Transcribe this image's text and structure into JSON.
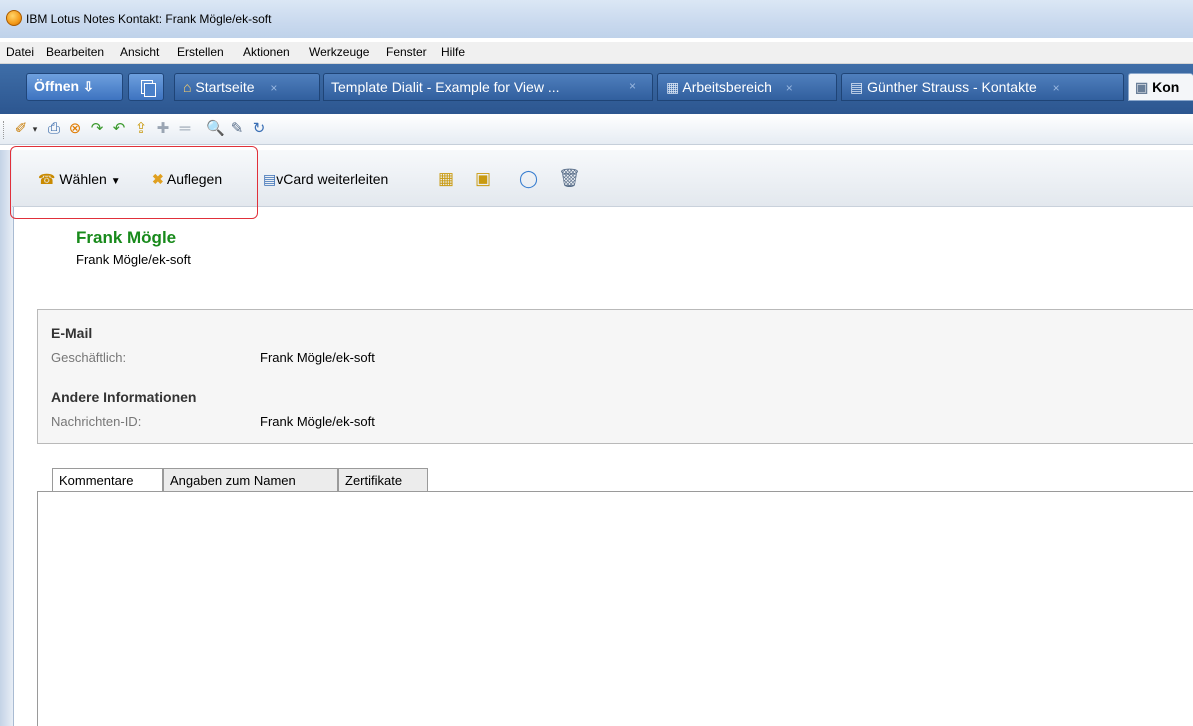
{
  "window": {
    "title": "IBM Lotus Notes Kontakt: Frank Mögle/ek-soft"
  },
  "menu": [
    "Datei",
    "Bearbeiten",
    "Ansicht",
    "Erstellen",
    "Aktionen",
    "Werkzeuge",
    "Fenster",
    "Hilfe"
  ],
  "tabstrip": {
    "open_label": "Öffnen",
    "tabs": [
      {
        "label": "Startseite",
        "icon": "home-icon"
      },
      {
        "label": "Template Dialit - Example for View ...",
        "icon": ""
      },
      {
        "label": "Arbeitsbereich",
        "icon": "workspace-icon"
      },
      {
        "label": "Günther Strauss - Kontakte",
        "icon": "contacts-icon"
      },
      {
        "label": "Kon",
        "icon": "contact-doc-icon"
      }
    ],
    "close_glyph": "×"
  },
  "actions": {
    "dial_label": "Wählen",
    "hangup_label": "Auflegen",
    "vcard_label": "vCard weiterleiten"
  },
  "contact": {
    "name": "Frank Mögle",
    "subtitle": "Frank Mögle/ek-soft"
  },
  "info": {
    "email_section": "E-Mail",
    "business_label": "Geschäftlich:",
    "business_value": "Frank Mögle/ek-soft",
    "other_section": "Andere Informationen",
    "message_id_label": "Nachrichten-ID:",
    "message_id_value": "Frank Mögle/ek-soft"
  },
  "bottom_tabs": [
    "Kommentare",
    "Angaben zum Namen",
    "Zertifikate"
  ],
  "colors": {
    "highlight": "#e0303a",
    "name_green": "#188a1b",
    "tab_blue": "#2c5690"
  }
}
